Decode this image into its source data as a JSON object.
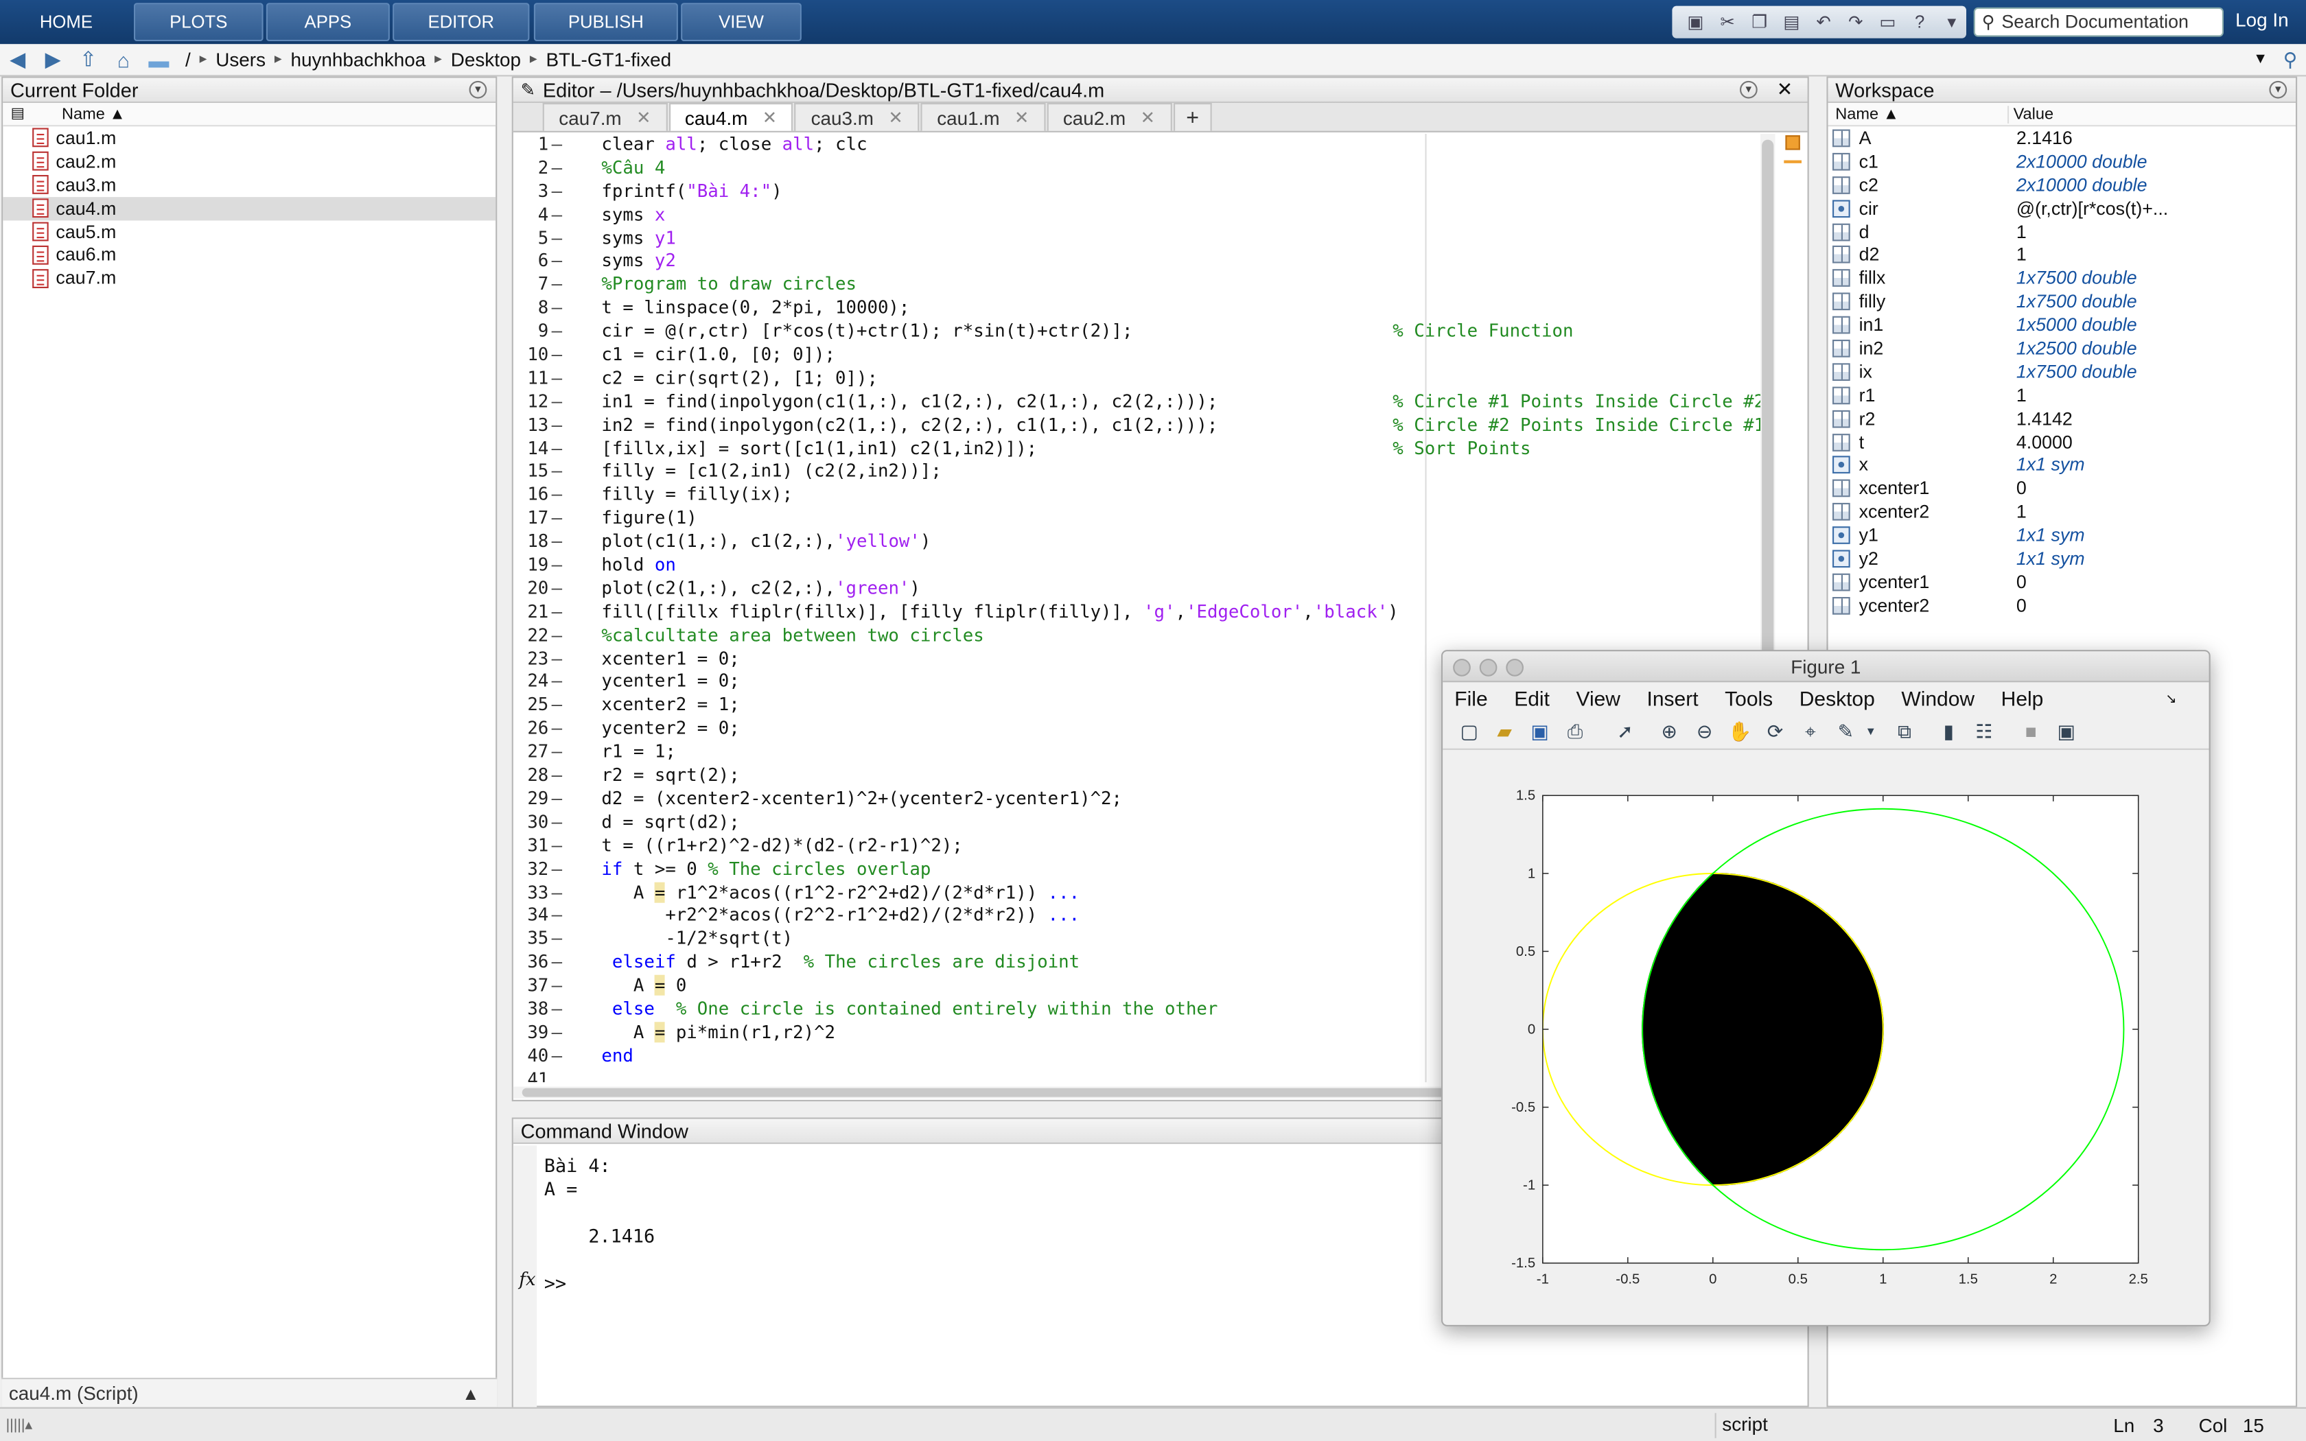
{
  "toolstrip": {
    "tabs": [
      "HOME",
      "PLOTS",
      "APPS",
      "EDITOR",
      "PUBLISH",
      "VIEW"
    ],
    "search_placeholder": "Search Documentation",
    "login": "Log In"
  },
  "address": {
    "root": "/",
    "path": [
      "Users",
      "huynhbachkhoa",
      "Desktop",
      "BTL-GT1-fixed"
    ]
  },
  "current_folder": {
    "title": "Current Folder",
    "column": "Name ▲",
    "files": [
      "cau1.m",
      "cau2.m",
      "cau3.m",
      "cau4.m",
      "cau5.m",
      "cau6.m",
      "cau7.m"
    ],
    "selected": "cau4.m",
    "details": "cau4.m  (Script)"
  },
  "editor": {
    "title": "Editor – /Users/huynhbachkhoa/Desktop/BTL-GT1-fixed/cau4.m",
    "tabs": [
      "cau7.m",
      "cau4.m",
      "cau3.m",
      "cau1.m",
      "cau2.m"
    ],
    "active_tab": "cau4.m",
    "lines": [
      "clear all; close all; clc",
      "%Câu 4",
      "fprintf(\"Bài 4:\")",
      "syms x",
      "syms y1",
      "syms y2",
      "%Program to draw circles",
      "t = linspace(0, 2*pi, 10000);",
      "cir = @(r,ctr) [r*cos(t)+ctr(1); r*sin(t)+ctr(2)];",
      "c1 = cir(1.0, [0; 0]);",
      "c2 = cir(sqrt(2), [1; 0]);",
      "in1 = find(inpolygon(c1(1,:), c1(2,:), c2(1,:), c2(2,:)));",
      "in2 = find(inpolygon(c2(1,:), c2(2,:), c1(1,:), c1(2,:)));",
      "[fillx,ix] = sort([c1(1,in1) c2(1,in2)]);",
      "filly = [c1(2,in1) (c2(2,in2))];",
      "filly = filly(ix);",
      "figure(1)",
      "plot(c1(1,:), c1(2,:),'yellow')",
      "hold on",
      "plot(c2(1,:), c2(2,:),'green')",
      "fill([fillx fliplr(fillx)], [filly fliplr(filly)], 'g','EdgeColor','black')",
      "%calcultate area between two circles",
      "xcenter1 = 0;",
      "ycenter1 = 0;",
      "xcenter2 = 1;",
      "ycenter2 = 0;",
      "r1 = 1;",
      "r2 = sqrt(2);",
      "d2 = (xcenter2-xcenter1)^2+(ycenter2-ycenter1)^2;",
      "d = sqrt(d2);",
      "t = ((r1+r2)^2-d2)*(d2-(r2-r1)^2);",
      "if t >= 0 % The circles overlap",
      "   A = r1^2*acos((r1^2-r2^2+d2)/(2*d*r1)) ...",
      "      +r2^2*acos((r2^2-r1^2+d2)/(2*d*r2)) ...",
      "      -1/2*sqrt(t)",
      " elseif d > r1+r2  % The circles are disjoint",
      "   A = 0",
      " else  % One circle is contained entirely within the other",
      "   A = pi*min(r1,r2)^2",
      "end",
      ""
    ],
    "comments": {
      "9": "% Circle Function",
      "12": "% Circle #1 Points Inside Circle #2",
      "13": "% Circle #2 Points Inside Circle #1",
      "14": "% Sort Points"
    }
  },
  "command_window": {
    "title": "Command Window",
    "output": [
      "Bài 4:",
      "A =",
      "",
      "    2.1416"
    ],
    "prompt": ">>"
  },
  "workspace": {
    "title": "Workspace",
    "col_name": "Name ▲",
    "col_value": "Value",
    "vars": [
      {
        "name": "A",
        "value": "2.1416",
        "italic": false,
        "obj": false
      },
      {
        "name": "c1",
        "value": "2x10000 double",
        "italic": true,
        "obj": false
      },
      {
        "name": "c2",
        "value": "2x10000 double",
        "italic": true,
        "obj": false
      },
      {
        "name": "cir",
        "value": "@(r,ctr)[r*cos(t)+...",
        "italic": false,
        "obj": true
      },
      {
        "name": "d",
        "value": "1",
        "italic": false,
        "obj": false
      },
      {
        "name": "d2",
        "value": "1",
        "italic": false,
        "obj": false
      },
      {
        "name": "fillx",
        "value": "1x7500 double",
        "italic": true,
        "obj": false
      },
      {
        "name": "filly",
        "value": "1x7500 double",
        "italic": true,
        "obj": false
      },
      {
        "name": "in1",
        "value": "1x5000 double",
        "italic": true,
        "obj": false
      },
      {
        "name": "in2",
        "value": "1x2500 double",
        "italic": true,
        "obj": false
      },
      {
        "name": "ix",
        "value": "1x7500 double",
        "italic": true,
        "obj": false
      },
      {
        "name": "r1",
        "value": "1",
        "italic": false,
        "obj": false
      },
      {
        "name": "r2",
        "value": "1.4142",
        "italic": false,
        "obj": false
      },
      {
        "name": "t",
        "value": "4.0000",
        "italic": false,
        "obj": false
      },
      {
        "name": "x",
        "value": "1x1 sym",
        "italic": true,
        "obj": true
      },
      {
        "name": "xcenter1",
        "value": "0",
        "italic": false,
        "obj": false
      },
      {
        "name": "xcenter2",
        "value": "1",
        "italic": false,
        "obj": false
      },
      {
        "name": "y1",
        "value": "1x1 sym",
        "italic": true,
        "obj": true
      },
      {
        "name": "y2",
        "value": "1x1 sym",
        "italic": true,
        "obj": true
      },
      {
        "name": "ycenter1",
        "value": "0",
        "italic": false,
        "obj": false
      },
      {
        "name": "ycenter2",
        "value": "0",
        "italic": false,
        "obj": false
      }
    ]
  },
  "status": {
    "mode": "script",
    "ln_label": "Ln",
    "ln": "3",
    "col_label": "Col",
    "col": "15"
  },
  "figure": {
    "title": "Figure 1",
    "menu": [
      "File",
      "Edit",
      "View",
      "Insert",
      "Tools",
      "Desktop",
      "Window",
      "Help"
    ],
    "chart_data": {
      "type": "line",
      "xlim": [
        -1,
        2.5
      ],
      "ylim": [
        -1.5,
        1.5
      ],
      "xticks": [
        "-1",
        "-0.5",
        "0",
        "0.5",
        "1",
        "1.5",
        "2",
        "2.5"
      ],
      "yticks": [
        "-1.5",
        "-1",
        "-0.5",
        "0",
        "0.5",
        "1",
        "1.5"
      ],
      "series": [
        {
          "center": [
            0,
            0
          ],
          "radius": 1,
          "color": "#ffff00"
        },
        {
          "center": [
            1,
            0
          ],
          "radius": 1.4142,
          "color": "#00ff00"
        }
      ],
      "filled_region": {
        "color": "#000000"
      }
    }
  }
}
